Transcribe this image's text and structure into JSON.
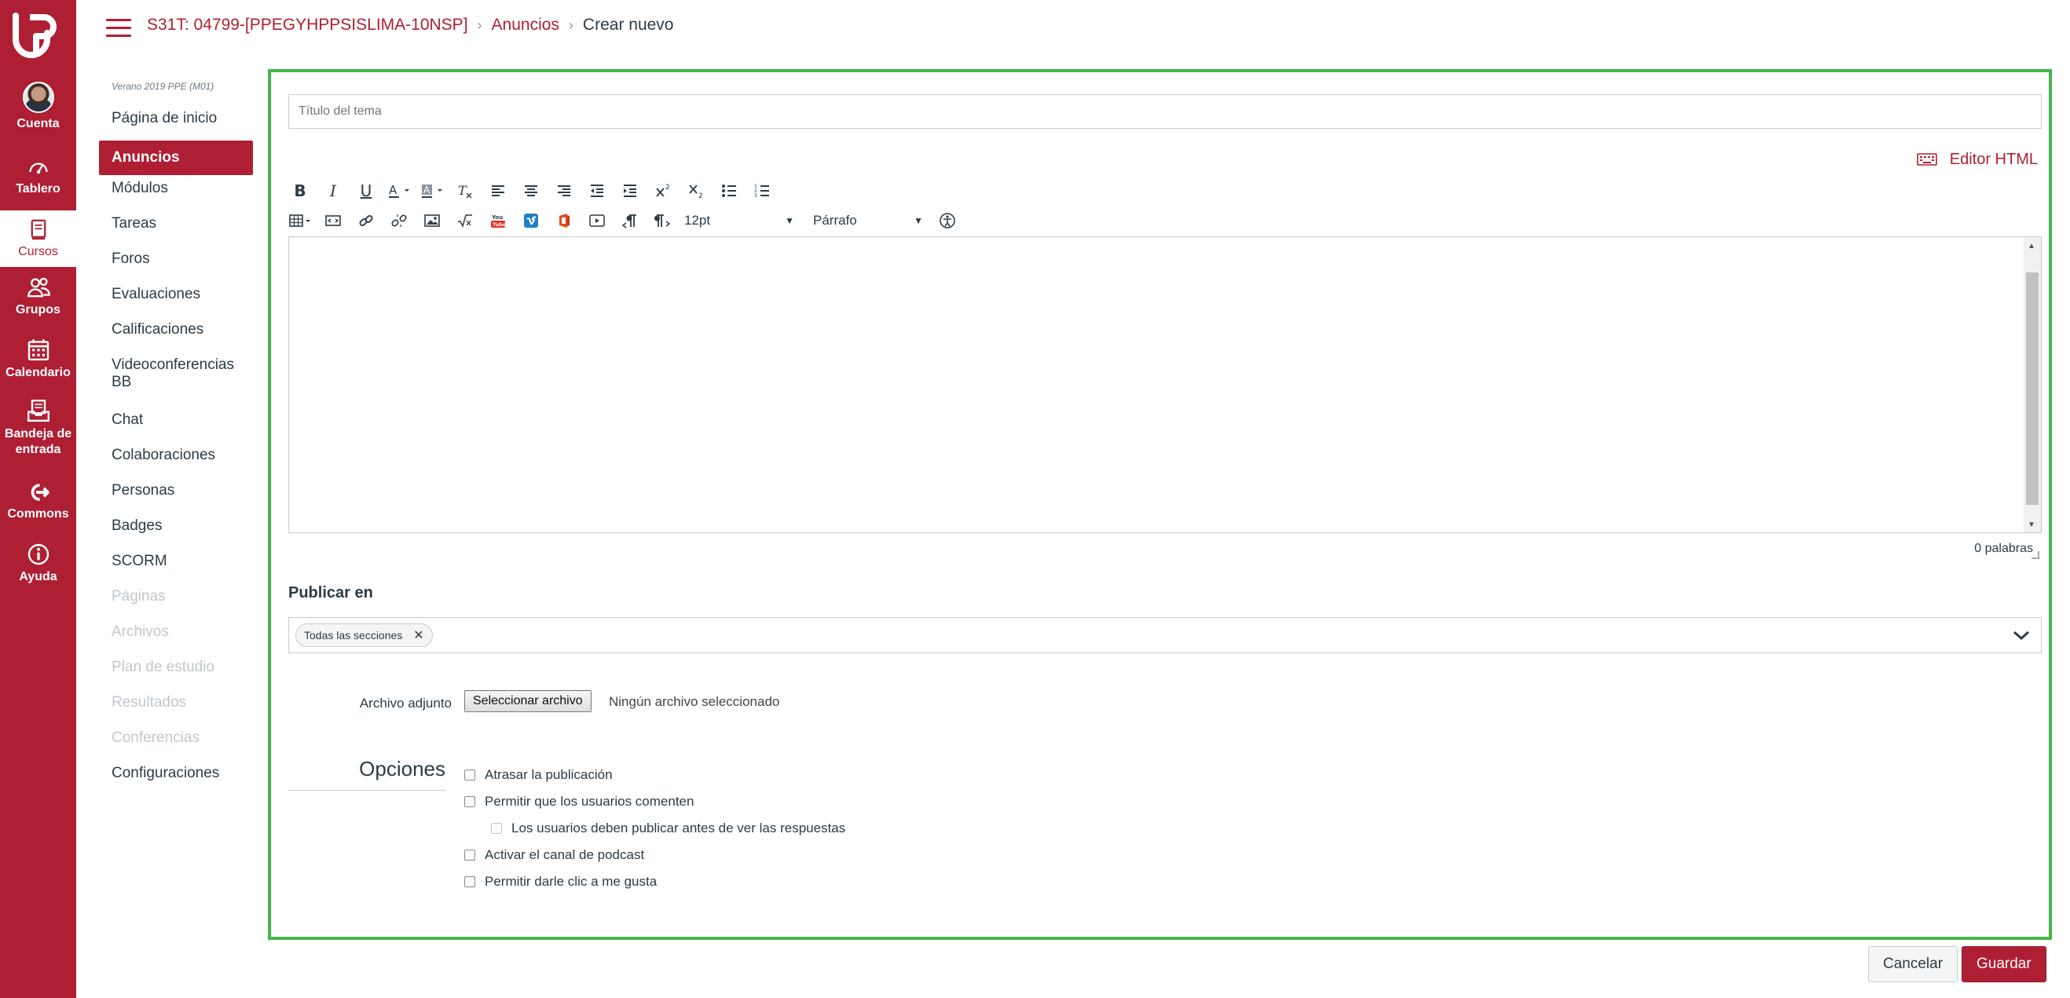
{
  "global_nav": {
    "items": [
      {
        "label": "Cuenta",
        "icon": "avatar"
      },
      {
        "label": "Tablero",
        "icon": "dashboard-icon"
      },
      {
        "label": "Cursos",
        "icon": "courses-icon"
      },
      {
        "label": "Grupos",
        "icon": "groups-icon"
      },
      {
        "label": "Calendario",
        "icon": "calendar-icon"
      },
      {
        "label": "Bandeja de entrada",
        "icon": "inbox-icon"
      },
      {
        "label": "Commons",
        "icon": "commons-icon"
      },
      {
        "label": "Ayuda",
        "icon": "help-icon"
      }
    ],
    "brand_color": "#ae1f33"
  },
  "breadcrumb": {
    "course": "S31T: 04799-[PPEGYHPPSISLIMA-10NSP]",
    "section": "Anuncios",
    "current": "Crear nuevo"
  },
  "course_nav": {
    "term": "Verano 2019 PPE (M01)",
    "items": [
      {
        "label": "Página de inicio"
      },
      {
        "label": "Anuncios"
      },
      {
        "label": "Módulos"
      },
      {
        "label": "Tareas"
      },
      {
        "label": "Foros"
      },
      {
        "label": "Evaluaciones"
      },
      {
        "label": "Calificaciones"
      },
      {
        "label": "Videoconferencias BB"
      },
      {
        "label": "Chat"
      },
      {
        "label": "Colaboraciones"
      },
      {
        "label": "Personas"
      },
      {
        "label": "Badges"
      },
      {
        "label": "SCORM"
      },
      {
        "label": "Páginas"
      },
      {
        "label": "Archivos"
      },
      {
        "label": "Plan de estudio"
      },
      {
        "label": "Resultados"
      },
      {
        "label": "Conferencias"
      },
      {
        "label": "Configuraciones"
      }
    ]
  },
  "form": {
    "title_placeholder": "Título del tema",
    "html_editor_label": "Editor HTML",
    "font_size": "12pt",
    "block_format": "Párrafo",
    "word_count": "0 palabras",
    "publish_label": "Publicar en",
    "publish_token": "Todas las secciones",
    "attachment_label": "Archivo adjunto",
    "file_button": "Seleccionar archivo",
    "file_status": "Ningún archivo seleccionado",
    "options_heading": "Opciones",
    "options": [
      {
        "label": "Atrasar la publicación",
        "checked": false
      },
      {
        "label": "Permitir que los usuarios comenten",
        "checked": false
      },
      {
        "label": "Los usuarios deben publicar antes de ver las respuestas",
        "checked": false,
        "disabled": true
      },
      {
        "label": "Activar el canal de podcast",
        "checked": false
      },
      {
        "label": "Permitir darle clic a me gusta",
        "checked": false
      }
    ]
  },
  "actions": {
    "cancel": "Cancelar",
    "save": "Guardar"
  }
}
